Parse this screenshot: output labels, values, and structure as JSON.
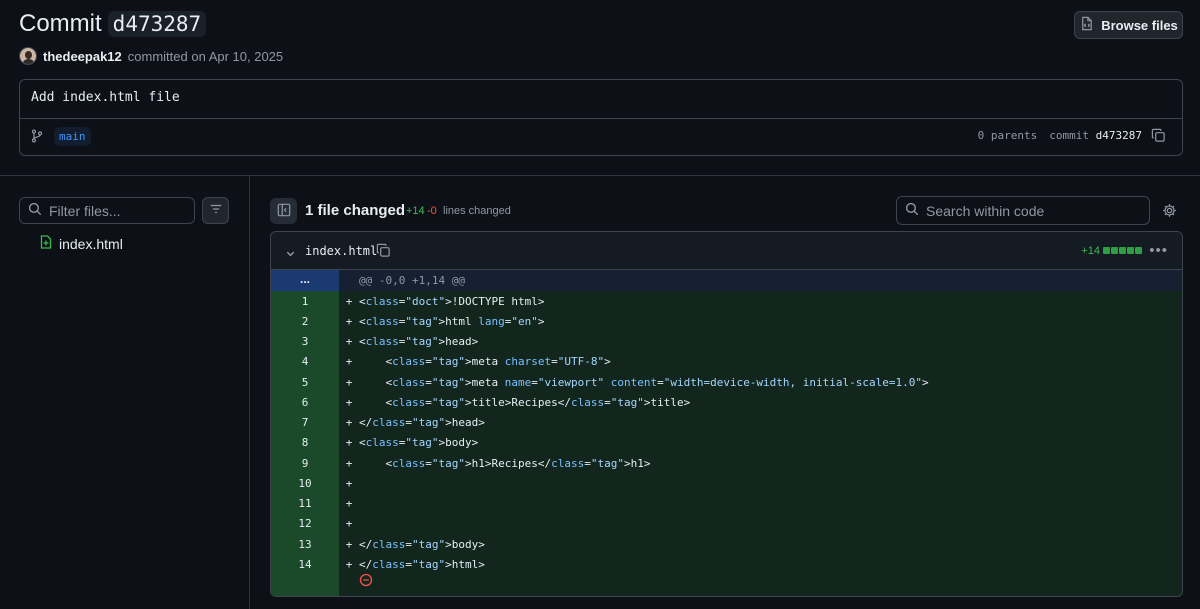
{
  "header": {
    "title": "Commit",
    "sha": "d473287",
    "browse_label": "Browse files",
    "author": "thedeepak12",
    "committed_text": "committed on Apr 10, 2025"
  },
  "commit": {
    "message": "Add index.html file",
    "branch": "main",
    "parents_text": "0 parents",
    "commit_label": "commit",
    "commit_sha": "d473287"
  },
  "sidebar": {
    "filter_placeholder": "Filter files...",
    "files": [
      {
        "name": "index.html",
        "icon": "file-added-icon"
      }
    ]
  },
  "toolbar": {
    "files_changed": "1 file changed",
    "additions": "+14",
    "deletions": "-0",
    "lines_changed_label": "lines changed",
    "search_placeholder": "Search within code"
  },
  "diff": {
    "filename": "index.html",
    "additions": "+14",
    "hunk_header": "@@ -0,0 +1,14 @@",
    "expand_label": "...",
    "lines": [
      {
        "n": "1",
        "sign": "+",
        "text": "<!DOCTYPE html>"
      },
      {
        "n": "2",
        "sign": "+",
        "text": "<html lang=\"en\">"
      },
      {
        "n": "3",
        "sign": "+",
        "text": "<head>"
      },
      {
        "n": "4",
        "sign": "+",
        "text": "    <meta charset=\"UTF-8\">"
      },
      {
        "n": "5",
        "sign": "+",
        "text": "    <meta name=\"viewport\" content=\"width=device-width, initial-scale=1.0\">"
      },
      {
        "n": "6",
        "sign": "+",
        "text": "    <title>Recipes</title>"
      },
      {
        "n": "7",
        "sign": "+",
        "text": "</head>"
      },
      {
        "n": "8",
        "sign": "+",
        "text": "<body>"
      },
      {
        "n": "9",
        "sign": "+",
        "text": "    <h1>Recipes</h1>"
      },
      {
        "n": "10",
        "sign": "+",
        "text": ""
      },
      {
        "n": "11",
        "sign": "+",
        "text": ""
      },
      {
        "n": "12",
        "sign": "+",
        "text": ""
      },
      {
        "n": "13",
        "sign": "+",
        "text": "</body>"
      },
      {
        "n": "14",
        "sign": "+",
        "text": "</html>"
      }
    ]
  },
  "colors": {
    "background": "#0d1117",
    "added_line": "#12261e",
    "added_gutter": "#1a4a29",
    "hunk_gutter": "#1c3a72",
    "addition_text": "#3fb950",
    "deletion_text": "#f85149",
    "link": "#4493f8"
  }
}
